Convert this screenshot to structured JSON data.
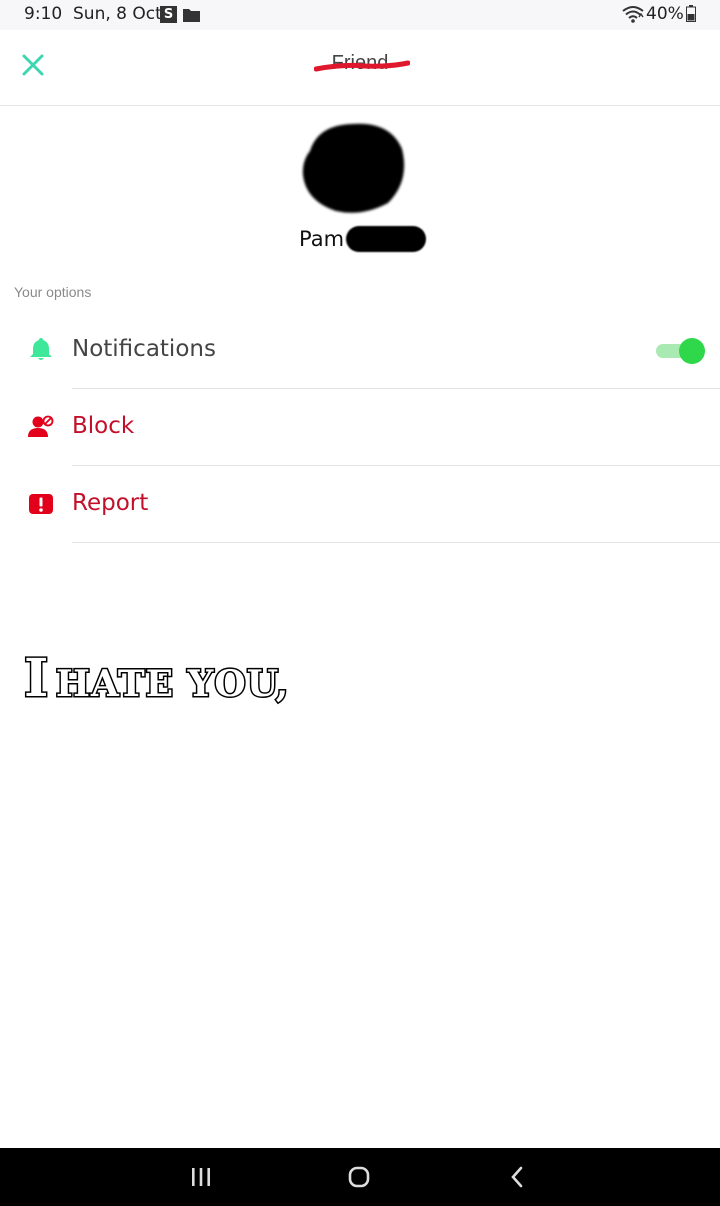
{
  "status_bar": {
    "time": "9:10",
    "date": "Sun, 8 Oct",
    "s_icon_letter": "S",
    "battery": "40%",
    "icons": [
      "s-app-icon",
      "folder-icon",
      "wifi-icon",
      "battery-icon"
    ]
  },
  "header": {
    "title": "Friend",
    "close_icon": "close-icon",
    "accent_color": "#3ed6b0",
    "strike_color": "#e0182d"
  },
  "profile": {
    "name": "Pam",
    "avatar_icon": "avatar-redacted"
  },
  "options": {
    "section_label": "Your options",
    "items": [
      {
        "label": "Notifications",
        "icon": "bell-icon",
        "color": "#444444",
        "icon_color": "#3de89a",
        "toggle_on": true
      },
      {
        "label": "Block",
        "icon": "block-user-icon",
        "color": "#c3102a",
        "icon_color": "#e3001b"
      },
      {
        "label": "Report",
        "icon": "report-icon",
        "color": "#c3102a",
        "icon_color": "#e3001b"
      }
    ]
  },
  "overlay": {
    "first": "I",
    "rest": "HATE YOU,"
  },
  "nav_bar": {
    "icons": [
      "recents-icon",
      "home-icon",
      "back-icon"
    ]
  }
}
